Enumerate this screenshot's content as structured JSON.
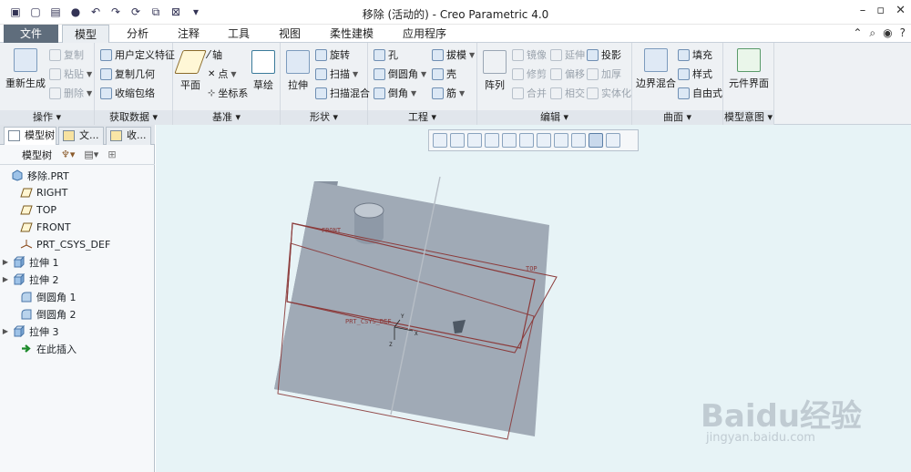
{
  "app": {
    "title": "移除 (活动的) - Creo Parametric 4.0"
  },
  "tabs": [
    {
      "label": "文件"
    },
    {
      "label": "模型"
    },
    {
      "label": "分析"
    },
    {
      "label": "注释"
    },
    {
      "label": "工具"
    },
    {
      "label": "视图"
    },
    {
      "label": "柔性建模"
    },
    {
      "label": "应用程序"
    }
  ],
  "ribbon": {
    "ops": {
      "regen": "重新生成",
      "copy": "复制",
      "paste": "粘贴",
      "delete": "删除",
      "title": "操作"
    },
    "getdata": {
      "udf": "用户定义特征",
      "copygeom": "复制几何",
      "shrink": "收缩包络",
      "title": "获取数据"
    },
    "datum": {
      "plane": "平面",
      "axis": "轴",
      "point": "点",
      "csys": "坐标系",
      "sketch": "草绘",
      "title": "基准"
    },
    "shapes": {
      "extrude": "拉伸",
      "revolve": "旋转",
      "sweep": "扫描",
      "swept_blend": "扫描混合",
      "title": "形状"
    },
    "eng": {
      "hole": "孔",
      "round": "倒圆角",
      "chamfer": "倒角",
      "draft": "拔模",
      "shell": "壳",
      "rib": "筋",
      "title": "工程"
    },
    "edit": {
      "pattern": "阵列",
      "mirror": "镜像",
      "trim": "修剪",
      "merge": "合并",
      "extend": "延伸",
      "offset": "偏移",
      "intersect": "相交",
      "project": "投影",
      "thicken": "加厚",
      "solidify": "实体化",
      "title": "编辑"
    },
    "surface": {
      "boundary": "边界混合",
      "fill": "填充",
      "style": "样式",
      "freestyle": "自由式",
      "title": "曲面"
    },
    "intent": {
      "component_interface": "元件界面",
      "title": "模型意图"
    }
  },
  "sidebar": {
    "tabs": [
      {
        "label": "模型树"
      },
      {
        "label": "文..."
      },
      {
        "label": "收..."
      }
    ],
    "tree_label": "模型树",
    "items": [
      {
        "label": "移除.PRT",
        "icon": "part-icon"
      },
      {
        "label": "RIGHT",
        "icon": "datum-plane-icon"
      },
      {
        "label": "TOP",
        "icon": "datum-plane-icon"
      },
      {
        "label": "FRONT",
        "icon": "datum-plane-icon"
      },
      {
        "label": "PRT_CSYS_DEF",
        "icon": "csys-icon"
      },
      {
        "label": "拉伸 1",
        "icon": "extrude-icon"
      },
      {
        "label": "拉伸 2",
        "icon": "extrude-icon"
      },
      {
        "label": "倒圆角 1",
        "icon": "round-icon"
      },
      {
        "label": "倒圆角 2",
        "icon": "round-icon"
      },
      {
        "label": "拉伸 3",
        "icon": "extrude-icon"
      },
      {
        "label": "在此插入",
        "icon": "insert-here-icon"
      }
    ]
  },
  "viewport": {
    "labels": {
      "front": "FRONT",
      "top": "TOP",
      "csys": "PRT_CSYS_DEF",
      "x": "X",
      "y": "Y",
      "z": "Z"
    }
  },
  "watermark": {
    "brand": "Baidu经验",
    "url": "jingyan.baidu.com"
  },
  "colors": {
    "file_tab": "#5f6d7c",
    "viewport_bg": "#e7f3f6",
    "part": "#9aa6b4",
    "datum": "#8b3a3a"
  }
}
